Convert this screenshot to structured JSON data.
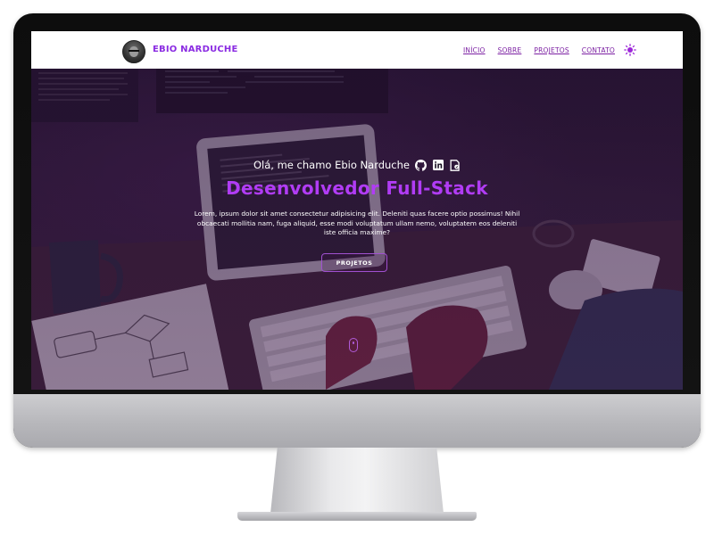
{
  "nav": {
    "brand": "EBIO NARDUCHE",
    "links": [
      "INÍCIO",
      "SOBRE",
      "PROJETOS",
      "CONTATO"
    ]
  },
  "hero": {
    "greeting": "Olá, me chamo Ebio Narduche",
    "role": "Desenvolvedor Full-Stack",
    "description": "Lorem, ipsum dolor sit amet consectetur adipisicing elit. Deleniti quas facere optio possimus! Nihil obcaecati mollitia nam, fuga aliquid, esse modi voluptatum ullam nemo, voluptatem eos deleniti iste officia maxime?",
    "button": "PROJETOS"
  },
  "icons": {
    "theme": "sun-icon",
    "social": [
      "github-icon",
      "linkedin-icon",
      "resume-icon"
    ],
    "scroll": "scroll-mouse-icon"
  },
  "colors": {
    "accent": "#b13cf5",
    "brand": "#8a2be2",
    "nav_link": "#7b1fa2"
  }
}
